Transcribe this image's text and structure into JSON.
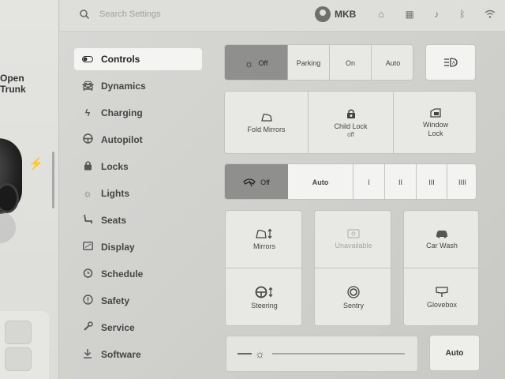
{
  "left_panel": {
    "trunk_line1": "Open",
    "trunk_line2": "Trunk"
  },
  "topbar": {
    "search_placeholder": "Search Settings",
    "user_name": "MKB"
  },
  "sidebar": {
    "items": [
      {
        "label": "Controls",
        "icon": "toggle-icon",
        "active": true
      },
      {
        "label": "Dynamics",
        "icon": "car-icon"
      },
      {
        "label": "Charging",
        "icon": "bolt-icon"
      },
      {
        "label": "Autopilot",
        "icon": "steering-wheel-icon"
      },
      {
        "label": "Locks",
        "icon": "lock-icon"
      },
      {
        "label": "Lights",
        "icon": "sun-icon"
      },
      {
        "label": "Seats",
        "icon": "seat-icon"
      },
      {
        "label": "Display",
        "icon": "display-icon"
      },
      {
        "label": "Schedule",
        "icon": "clock-icon"
      },
      {
        "label": "Safety",
        "icon": "safety-icon"
      },
      {
        "label": "Service",
        "icon": "wrench-icon"
      },
      {
        "label": "Software",
        "icon": "download-icon"
      }
    ]
  },
  "lights": {
    "off": "Off",
    "parking": "Parking",
    "on": "On",
    "auto": "Auto"
  },
  "controls": {
    "fold_mirrors": "Fold Mirrors",
    "child_lock": "Child Lock",
    "child_lock_status": "off",
    "window_lock": "Window Lock"
  },
  "wipers": {
    "off": "Off",
    "auto": "Auto",
    "speeds": [
      "I",
      "II",
      "III",
      "IIII"
    ]
  },
  "adjust": {
    "mirrors": "Mirrors",
    "unavailable": "Unavailable",
    "car_wash": "Car Wash",
    "steering": "Steering",
    "sentry": "Sentry",
    "glovebox": "Glovebox"
  },
  "brightness": {
    "auto": "Auto"
  },
  "colors": {
    "selected": "#8f8f8d",
    "background": "#d6d6d3"
  }
}
